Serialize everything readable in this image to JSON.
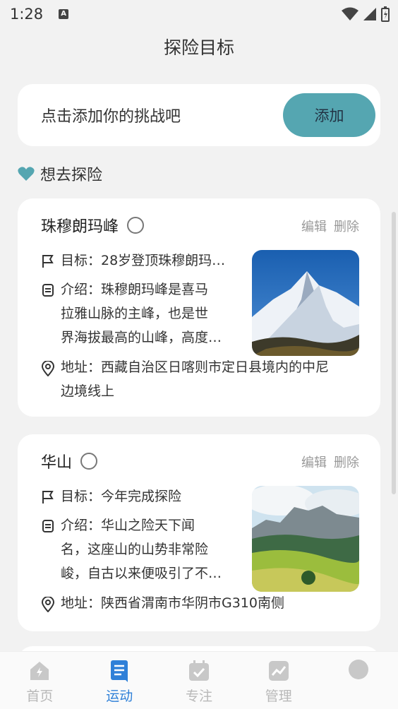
{
  "status": {
    "time": "1:28",
    "badge": "A"
  },
  "page": {
    "title": "探险目标"
  },
  "add": {
    "prompt": "点击添加你的挑战吧",
    "button": "添加"
  },
  "section": {
    "title": "想去探险"
  },
  "cards": [
    {
      "title": "珠穆朗玛峰",
      "edit": "编辑",
      "delete": "删除",
      "goal": "目标：28岁登顶珠穆朗玛…",
      "intro": [
        "介绍：珠穆朗玛峰是喜马",
        "拉雅山脉的主峰，也是世",
        "界海拔最高的山峰，高度…"
      ],
      "address": [
        "地址：西藏自治区日喀则市定日县境内的中尼",
        "边境线上"
      ]
    },
    {
      "title": "华山",
      "edit": "编辑",
      "delete": "删除",
      "goal": "目标：今年完成探险",
      "intro": [
        "介绍：华山之险天下闻",
        "名，这座山的山势非常险",
        "峻，自古以来便吸引了不…"
      ],
      "address": [
        "地址：陕西省渭南市华阴市G310南侧"
      ]
    }
  ],
  "nav": [
    {
      "label": "首页",
      "icon": "home-icon"
    },
    {
      "label": "运动",
      "icon": "note-icon",
      "active": true
    },
    {
      "label": "专注",
      "icon": "calendar-check-icon"
    },
    {
      "label": "管理",
      "icon": "chart-icon"
    }
  ],
  "colors": {
    "accent": "#55a6b1",
    "nav_active": "#2f80d8"
  }
}
